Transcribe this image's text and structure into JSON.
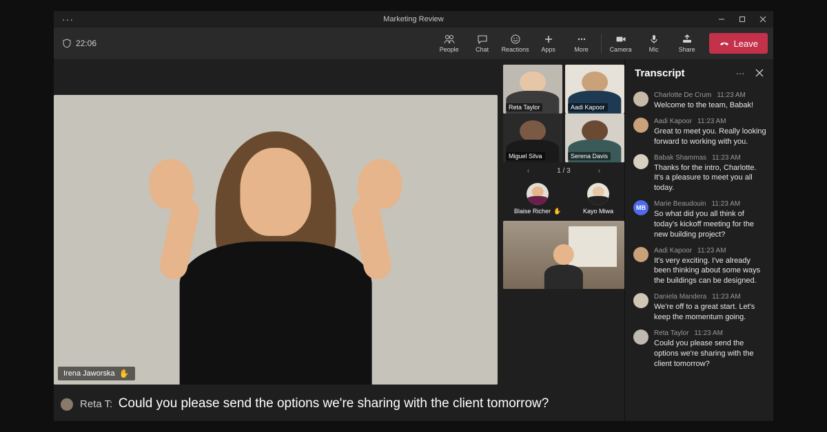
{
  "window_title": "Marketing Review",
  "call_duration": "22:06",
  "toolbar": {
    "people": "People",
    "chat": "Chat",
    "reactions": "Reactions",
    "apps": "Apps",
    "more": "More",
    "camera": "Camera",
    "mic": "Mic",
    "share": "Share",
    "leave": "Leave"
  },
  "primary_speaker": "Irena Jaworska",
  "tiles": [
    {
      "name": "Reta Taylor",
      "selected": true,
      "bg": "#bfbab1",
      "skin": "#e7c6a8",
      "shirt": "#3b3b3b"
    },
    {
      "name": "Aadi Kapoor",
      "selected": false,
      "bg": "#e6e2d9",
      "skin": "#caa27a",
      "shirt": "#1d3a52"
    },
    {
      "name": "Miguel Silva",
      "selected": false,
      "bg": "#2a2a2a",
      "skin": "#7a5a44",
      "shirt": "#1a1a1a"
    },
    {
      "name": "Serena Davis",
      "selected": false,
      "bg": "#d6d1c8",
      "skin": "#6b4a34",
      "shirt": "#3a5a5a"
    }
  ],
  "pager": {
    "current": "1",
    "total": "3"
  },
  "overflow_participants": [
    {
      "name": "Blaise Richer",
      "hand_raised": true,
      "bg": "#e2ded6",
      "skin": "#e6b58b",
      "shirt": "#6a1e4a"
    },
    {
      "name": "Kayo Miwa",
      "hand_raised": false,
      "bg": "#e8e4db",
      "skin": "#e6c8a8",
      "shirt": "#222"
    }
  ],
  "caption": {
    "speaker": "Reta T:",
    "text": "Could you please send the options we're sharing with the client tomorrow?"
  },
  "transcript_title": "Transcript",
  "transcript": [
    {
      "author": "Charlotte De Crum",
      "time": "11:23 AM",
      "text": "Welcome to the team, Babak!",
      "avatar_bg": "#c8baa8",
      "initials": ""
    },
    {
      "author": "Aadi Kapoor",
      "time": "11:23 AM",
      "text": "Great to meet you. Really looking forward to working with you.",
      "avatar_bg": "#caa27a",
      "initials": ""
    },
    {
      "author": "Babak Shammas",
      "time": "11:23 AM",
      "text": "Thanks for the intro, Charlotte. It's a pleasure to meet you all today.",
      "avatar_bg": "#d8cfc0",
      "initials": ""
    },
    {
      "author": "Marie Beaudouin",
      "time": "11:23 AM",
      "text": "So what did you all think of today's kickoff meeting for the new building project?",
      "avatar_bg": "#4f6bed",
      "initials": "MB"
    },
    {
      "author": "Aadi Kapoor",
      "time": "11:23 AM",
      "text": "It's very exciting. I've already been thinking about some ways the buildings can be designed.",
      "avatar_bg": "#caa27a",
      "initials": ""
    },
    {
      "author": "Daniela Mandera",
      "time": "11:23 AM",
      "text": "We're off to a great start. Let's keep the momentum going.",
      "avatar_bg": "#d0c6b6",
      "initials": ""
    },
    {
      "author": "Reta Taylor",
      "time": "11:23 AM",
      "text": "Could you please send the options we're sharing with the client tomorrow?",
      "avatar_bg": "#bfbab1",
      "initials": ""
    }
  ]
}
